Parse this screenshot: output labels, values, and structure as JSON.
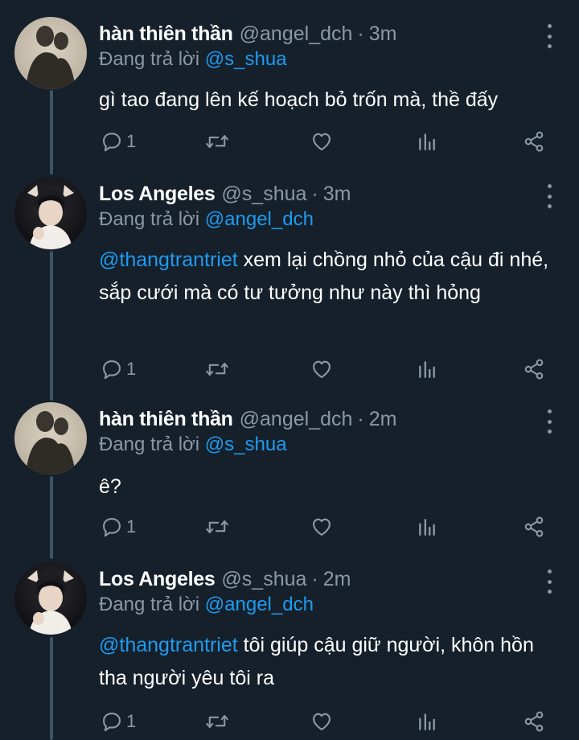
{
  "tweets": [
    {
      "name": "hàn thiên thần",
      "handle": "@angel_dch",
      "time": "3m",
      "reply_prefix": "Đang trả lời",
      "reply_to": "@s_shua",
      "mention": "",
      "text": "gì tao đang lên kế hoạch bỏ trốn mà, thề đấy",
      "reply_count": "1",
      "avatar": "angel"
    },
    {
      "name": "Los Angeles",
      "handle": "@s_shua",
      "time": "3m",
      "reply_prefix": "Đang trả lời",
      "reply_to": "@angel_dch",
      "mention": "@thangtrantriet",
      "text": " xem lại chồng nhỏ của cậu đi nhé, sắp cưới mà có tư tưởng như này thì hỏng",
      "reply_count": "1",
      "avatar": "shua"
    },
    {
      "name": "hàn thiên thần",
      "handle": "@angel_dch",
      "time": "2m",
      "reply_prefix": "Đang trả lời",
      "reply_to": "@s_shua",
      "mention": "",
      "text": "ê?",
      "reply_count": "1",
      "avatar": "angel"
    },
    {
      "name": "Los Angeles",
      "handle": "@s_shua",
      "time": "2m",
      "reply_prefix": "Đang trả lời",
      "reply_to": "@angel_dch",
      "mention": "@thangtrantriet",
      "text": " tôi giúp cậu giữ người, khôn hồn tha người yêu tôi ra",
      "reply_count": "1",
      "avatar": "shua"
    }
  ],
  "separator": "·",
  "icons": {
    "reply": "reply-icon",
    "retweet": "retweet-icon",
    "like": "heart-icon",
    "views": "analytics-icon",
    "share": "share-icon",
    "more": "more-options-icon"
  },
  "colors": {
    "background": "#15202b",
    "text": "#ffffff",
    "muted": "#8b98a5",
    "accent": "#1d9bf0",
    "thread_line": "#3d5466"
  }
}
